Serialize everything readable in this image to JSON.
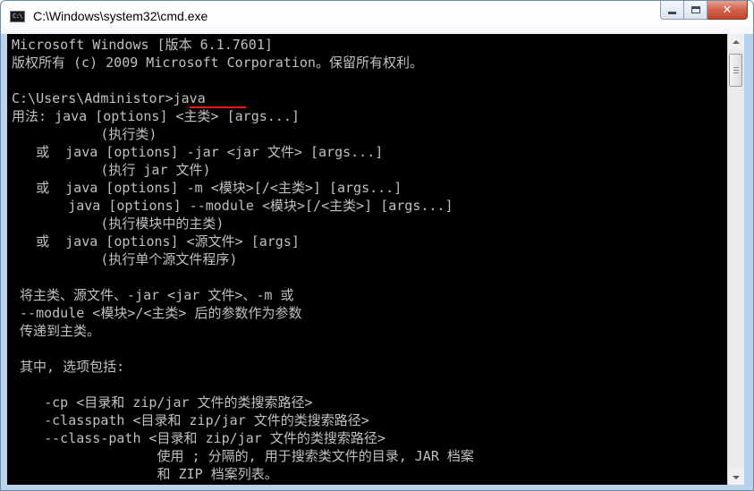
{
  "window": {
    "title": "C:\\Windows\\system32\\cmd.exe",
    "icon_text": "C:\\"
  },
  "caption_buttons": {
    "minimize_icon": "minimize-icon",
    "maximize_icon": "maximize-icon",
    "close_icon": "close-icon",
    "close_glyph": "✕"
  },
  "console": {
    "background": "#000000",
    "foreground": "#c0c0c0",
    "highlight_color": "#e31b1b",
    "lines": [
      "Microsoft Windows [版本 6.1.7601]",
      "版权所有 (c) 2009 Microsoft Corporation。保留所有权利。",
      "",
      "C:\\Users\\Administor>java",
      "用法: java [options] <主类> [args...]",
      "           (执行类)",
      "   或  java [options] -jar <jar 文件> [args...]",
      "           (执行 jar 文件)",
      "   或  java [options] -m <模块>[/<主类>] [args...]",
      "       java [options] --module <模块>[/<主类>] [args...]",
      "           (执行模块中的主类)",
      "   或  java [options] <源文件> [args]",
      "           (执行单个源文件程序)",
      "",
      " 将主类、源文件、-jar <jar 文件>、-m 或",
      " --module <模块>/<主类> 后的参数作为参数",
      " 传递到主类。",
      "",
      " 其中, 选项包括:",
      "",
      "    -cp <目录和 zip/jar 文件的类搜索路径>",
      "    -classpath <目录和 zip/jar 文件的类搜索路径>",
      "    --class-path <目录和 zip/jar 文件的类搜索路径>",
      "                  使用 ; 分隔的, 用于搜索类文件的目录, JAR 档案",
      "                  和 ZIP 档案列表。"
    ]
  },
  "scrollbar": {
    "up_icon": "scroll-up-arrow-icon",
    "down_icon": "scroll-down-arrow-icon"
  }
}
